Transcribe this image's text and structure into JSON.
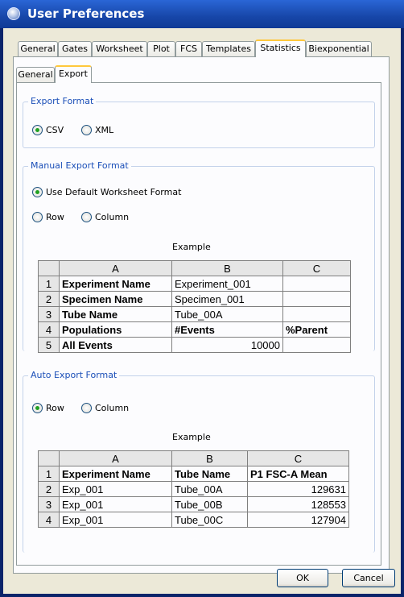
{
  "window": {
    "title": "User Preferences"
  },
  "top_tabs": [
    "General",
    "Gates",
    "Worksheet",
    "Plot",
    "FCS",
    "Templates",
    "Statistics",
    "Biexponential"
  ],
  "top_tab_active": "Statistics",
  "inner_tabs": [
    "General",
    "Export"
  ],
  "inner_tab_active": "Export",
  "export_format": {
    "label": "Export Format",
    "options": [
      "CSV",
      "XML"
    ],
    "selected": "CSV"
  },
  "manual_export": {
    "label": "Manual Export Format",
    "use_default": "Use Default Worksheet Format",
    "options": [
      "Row",
      "Column"
    ],
    "example_label": "Example",
    "table": {
      "columns": [
        "A",
        "B",
        "C"
      ],
      "rows": [
        {
          "n": "1",
          "a": "Experiment Name",
          "b": "Experiment_001",
          "c": ""
        },
        {
          "n": "2",
          "a": "Specimen Name",
          "b": "Specimen_001",
          "c": ""
        },
        {
          "n": "3",
          "a": "Tube Name",
          "b": "Tube_00A",
          "c": ""
        },
        {
          "n": "4",
          "a": "Populations",
          "b": "#Events",
          "c": "%Parent"
        },
        {
          "n": "5",
          "a": "All Events",
          "b": "10000",
          "c": ""
        }
      ]
    }
  },
  "auto_export": {
    "label": "Auto Export Format",
    "options": [
      "Row",
      "Column"
    ],
    "selected": "Row",
    "example_label": "Example",
    "table": {
      "columns": [
        "A",
        "B",
        "C"
      ],
      "rows": [
        {
          "n": "1",
          "a": "Experiment Name",
          "b": "Tube Name",
          "c": "P1 FSC-A Mean"
        },
        {
          "n": "2",
          "a": "Exp_001",
          "b": "Tube_00A",
          "c": "129631"
        },
        {
          "n": "3",
          "a": "Exp_001",
          "b": "Tube_00B",
          "c": "128553"
        },
        {
          "n": "4",
          "a": "Exp_001",
          "b": "Tube_00C",
          "c": "127904"
        }
      ]
    }
  },
  "buttons": {
    "ok": "OK",
    "cancel": "Cancel"
  }
}
